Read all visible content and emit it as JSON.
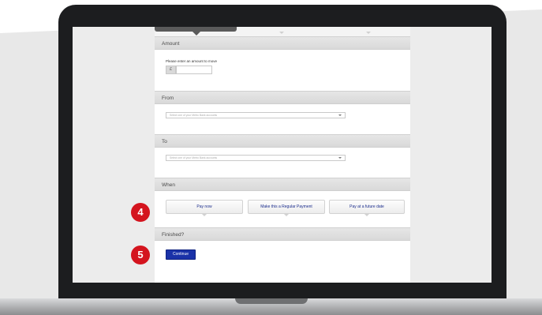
{
  "colors": {
    "badge": "#d4141e",
    "continue_button": "#1a32a8",
    "link_text": "#1a2c8c"
  },
  "form": {
    "amount": {
      "header": "Amount",
      "prompt": "Please enter an amount to move",
      "currency": "£",
      "value": ""
    },
    "from": {
      "header": "From",
      "placeholder": "Select one of your Metro Bank accounts"
    },
    "to": {
      "header": "To",
      "placeholder": "Select one of your Metro Bank accounts"
    },
    "when": {
      "header": "When",
      "options": [
        {
          "label": "Pay now"
        },
        {
          "label": "Make this a Regular Payment"
        },
        {
          "label": "Pay at a future date"
        }
      ]
    },
    "finished": {
      "header": "Finished?",
      "continue_label": "Continue"
    }
  },
  "steps": [
    {
      "number": "4"
    },
    {
      "number": "5"
    }
  ]
}
